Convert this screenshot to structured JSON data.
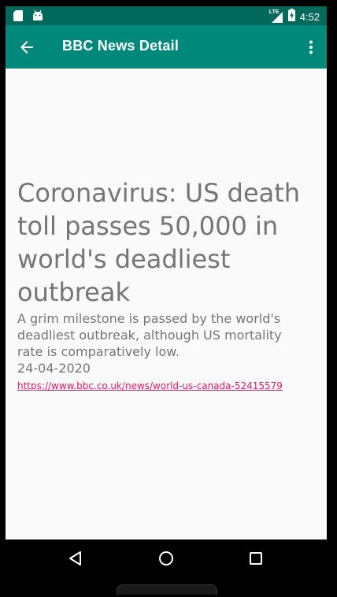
{
  "status_bar": {
    "time": "4:52",
    "network": "LTE",
    "left_icons": [
      "sd-card-icon",
      "android-icon"
    ],
    "right_icons": [
      "lte-signal-icon",
      "battery-charging-icon"
    ]
  },
  "app_bar": {
    "title": "BBC News Detail",
    "background_color": "#00897b",
    "status_bar_color": "#00695c",
    "back_icon": "arrow-back-icon",
    "menu_icon": "more-vert-icon"
  },
  "article": {
    "headline": "Coronavirus: US death toll passes 50,000 in world's deadliest outbreak",
    "summary": "A grim milestone is passed by the world's deadliest outbreak, although US mortality rate is comparatively low.",
    "date": "24-04-2020",
    "url": "https://www.bbc.co.uk/news/world-us-canada-52415579",
    "link_color": "#d81b60",
    "text_color": "#757575"
  },
  "nav_bar": {
    "buttons": [
      "back-triangle-icon",
      "home-circle-icon",
      "recents-square-icon"
    ]
  }
}
